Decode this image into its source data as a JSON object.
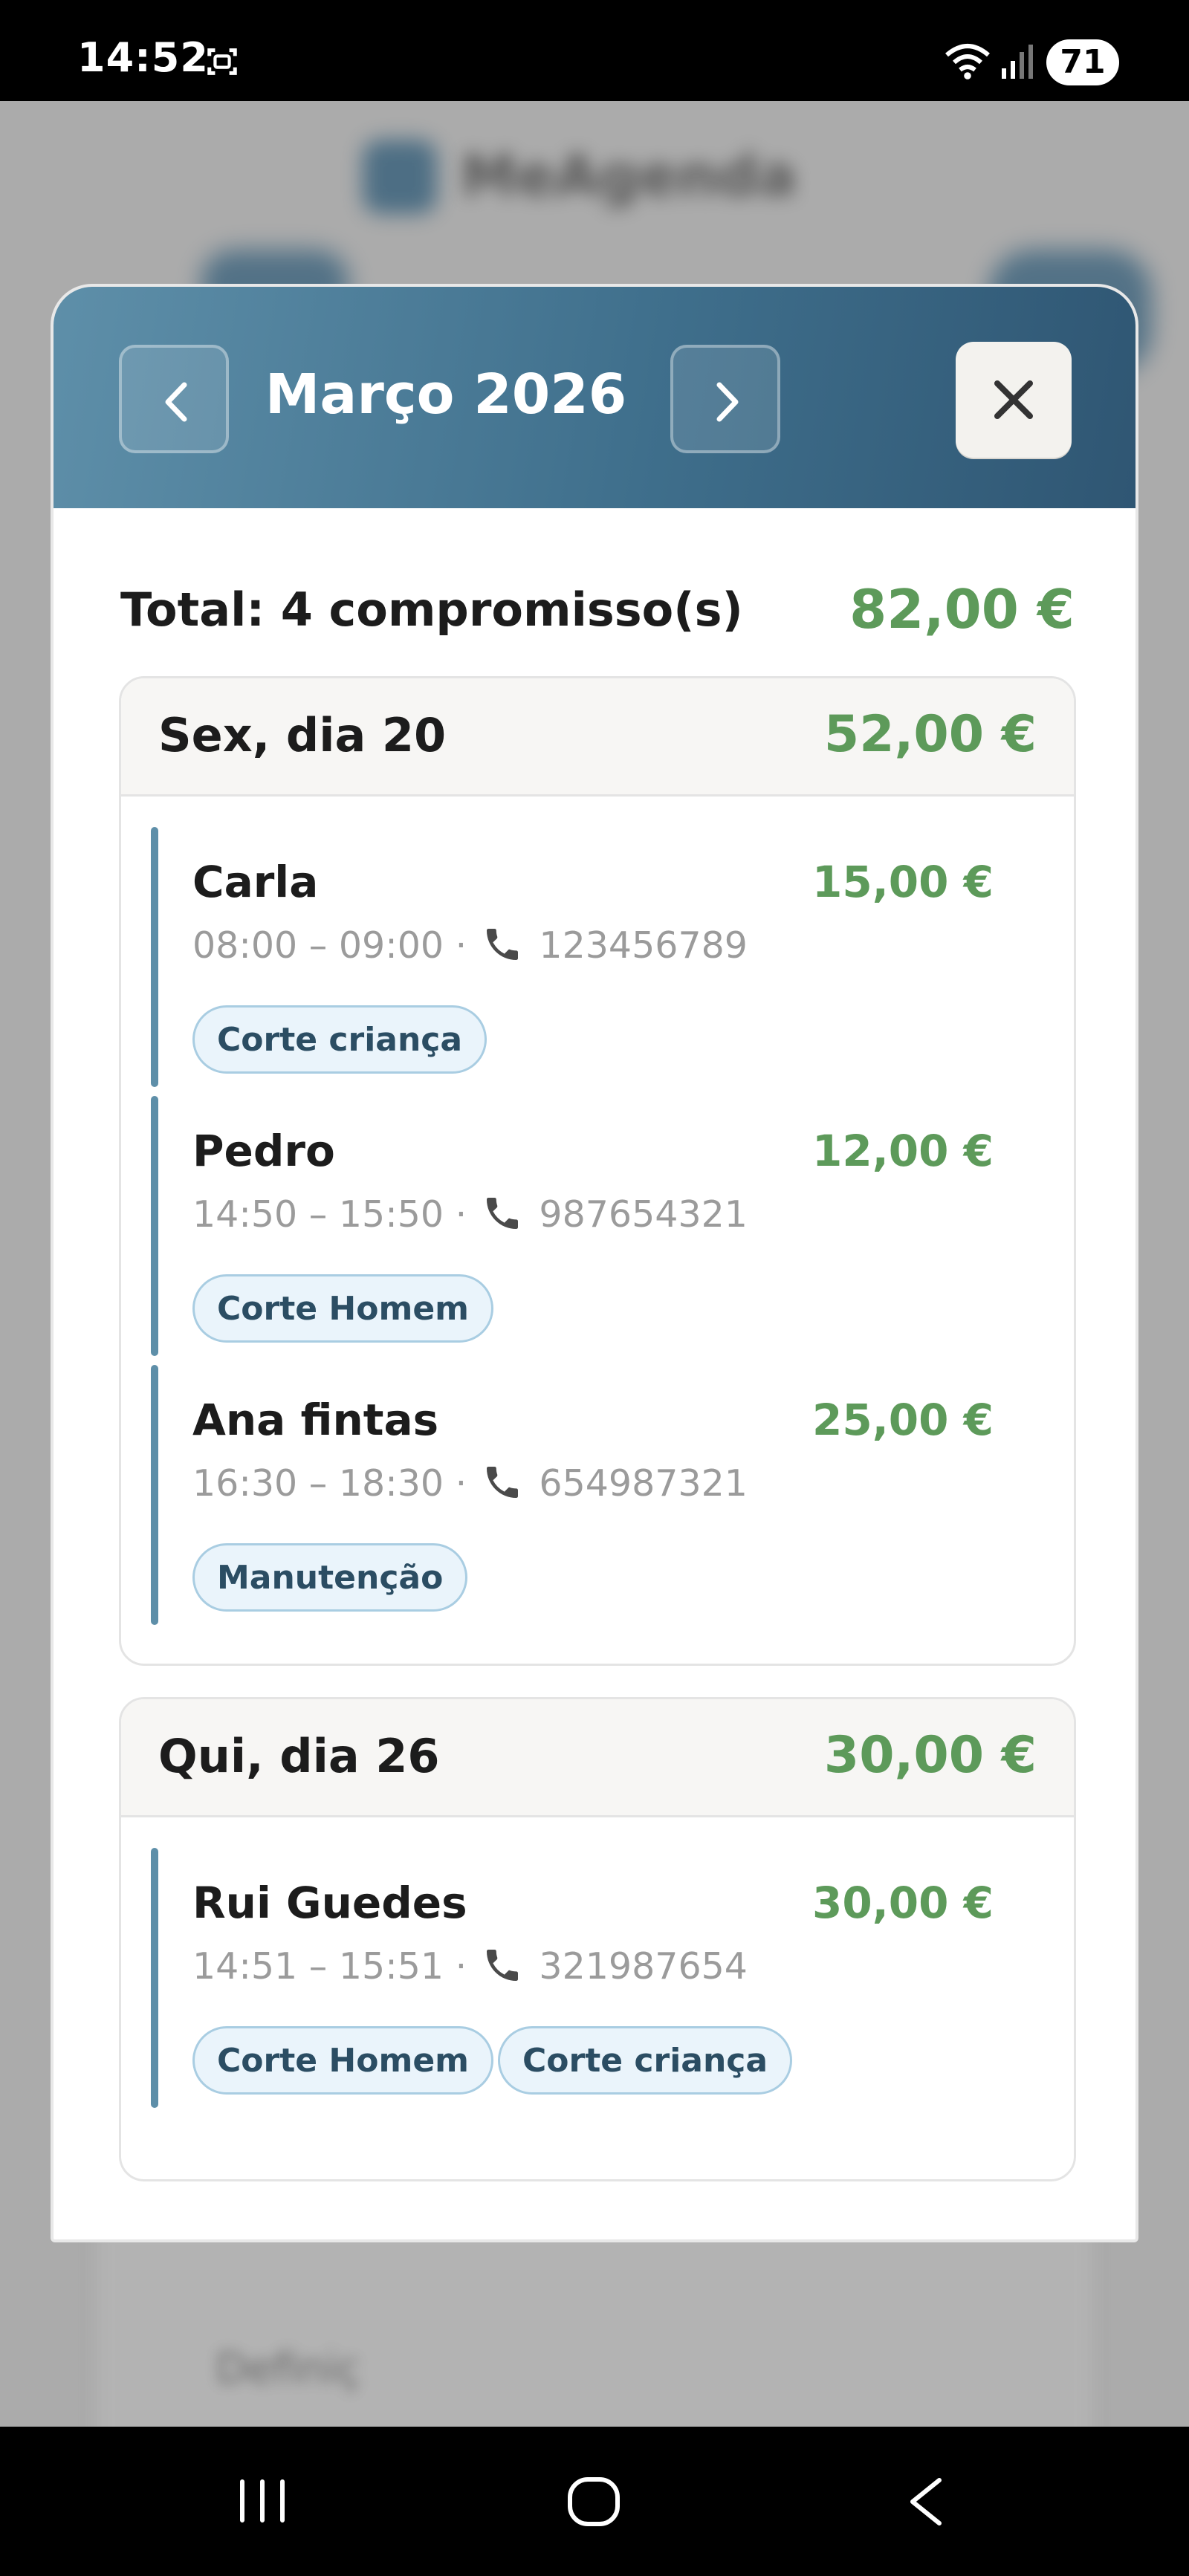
{
  "status_bar": {
    "time": "14:52",
    "battery": "71"
  },
  "background_app": {
    "title": "MeAgenda",
    "bottom_text": "Definiç"
  },
  "modal": {
    "month_title": "Março 2026",
    "total_label": "Total: 4 compromisso(s)",
    "total_amount": "82,00 €",
    "days": [
      {
        "label": "Sex, dia 20",
        "amount": "52,00 €",
        "appointments": [
          {
            "name": "Carla",
            "price": "15,00 €",
            "time": "08:00 – 09:00 ·",
            "phone": "123456789",
            "tags": [
              "Corte criança"
            ]
          },
          {
            "name": "Pedro",
            "price": "12,00 €",
            "time": "14:50 – 15:50 ·",
            "phone": "987654321",
            "tags": [
              "Corte Homem"
            ]
          },
          {
            "name": "Ana fintas",
            "price": "25,00 €",
            "time": "16:30 – 18:30 ·",
            "phone": "654987321",
            "tags": [
              "Manutenção"
            ]
          }
        ]
      },
      {
        "label": "Qui, dia 26",
        "amount": "30,00 €",
        "appointments": [
          {
            "name": "Rui Guedes",
            "price": "30,00 €",
            "time": "14:51 – 15:51 ·",
            "phone": "321987654",
            "tags": [
              "Corte Homem",
              "Corte criança"
            ]
          }
        ]
      }
    ]
  },
  "icons": {
    "prev": "chevron-left-icon",
    "next": "chevron-right-icon",
    "close": "close-icon",
    "phone": "phone-icon"
  },
  "colors": {
    "header_gradient_start": "#5e8fa9",
    "header_gradient_end": "#2f5673",
    "amount_green": "#5d9a5a",
    "tag_background": "#eaf4fb",
    "tag_border": "#a9cde2",
    "accent_bar": "#5e8fa9"
  }
}
